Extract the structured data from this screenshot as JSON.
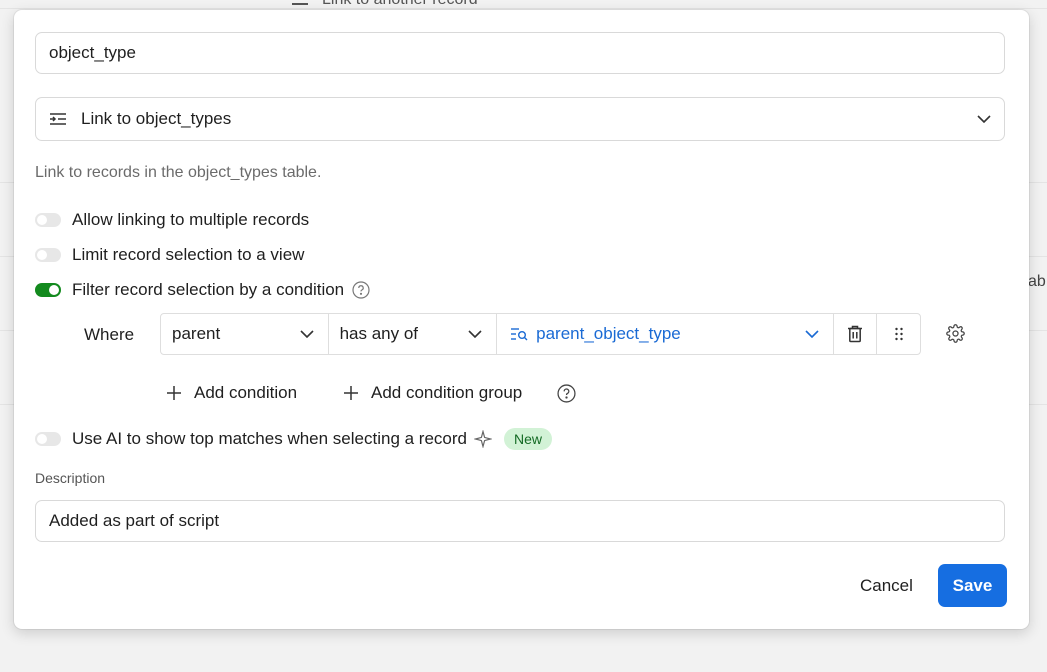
{
  "background": {
    "top_text": "Link to another record",
    "right_text": "ab"
  },
  "dialog": {
    "field_name": "object_type",
    "field_type": {
      "label": "Link to object_types",
      "icon": "link-fields-icon"
    },
    "helper_text": "Link to records in the object_types table.",
    "options": [
      {
        "label": "Allow linking to multiple records",
        "enabled": false
      },
      {
        "label": "Limit record selection to a view",
        "enabled": false
      },
      {
        "label": "Filter record selection by a condition",
        "enabled": true
      }
    ],
    "condition": {
      "where_label": "Where",
      "field": "parent",
      "operator": "has any of",
      "value": "parent_object_type"
    },
    "add_condition_label": "Add condition",
    "add_condition_group_label": "Add condition group",
    "ai_option": {
      "label": "Use AI to show top matches when selecting a record",
      "enabled": false,
      "badge": "New"
    },
    "description_label": "Description",
    "description_value": "Added as part of script",
    "cancel_label": "Cancel",
    "save_label": "Save"
  },
  "colors": {
    "accent": "#166ee1",
    "toggle_on": "#138a1e",
    "value_link": "#1a6ad4",
    "badge_bg": "#d2f2d6"
  }
}
